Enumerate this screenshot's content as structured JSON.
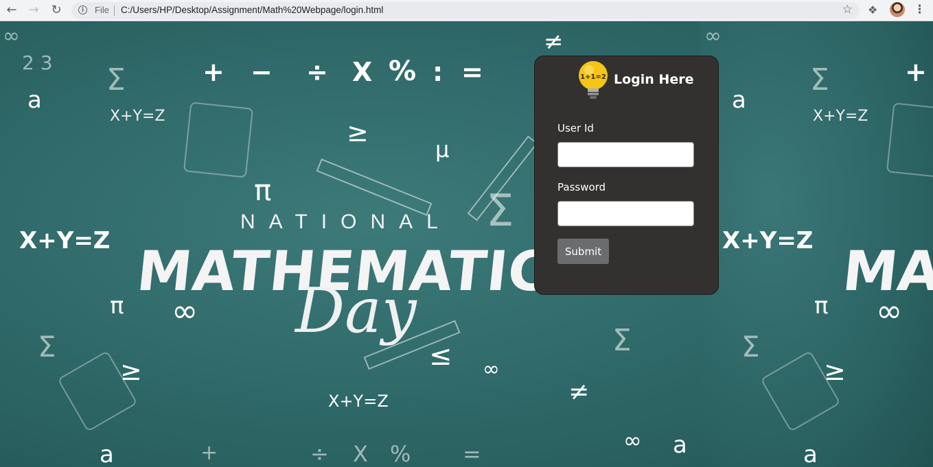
{
  "browser": {
    "file_label": "File",
    "url": "C:/Users/HP/Desktop/Assignment/Math%20Webpage/login.html"
  },
  "background": {
    "heading_small": "NATIONAL",
    "heading_big": "MATHEMATICS",
    "heading_script": "Day",
    "heading_big_repeat": "MA",
    "operators": [
      "+",
      "−",
      "÷",
      "X",
      "%",
      ":",
      "="
    ],
    "equation": "X+Y=Z"
  },
  "login": {
    "title": "Login Here",
    "logo_text": "1+1=2",
    "userid_label": "User Id",
    "userid_value": "",
    "password_label": "Password",
    "password_value": "",
    "submit_label": "Submit"
  },
  "colors": {
    "card_bg": "#333130",
    "chalkboard": "#2f6b6b",
    "submit_bg": "#6b6c6e",
    "bulb": "#f5c518"
  }
}
